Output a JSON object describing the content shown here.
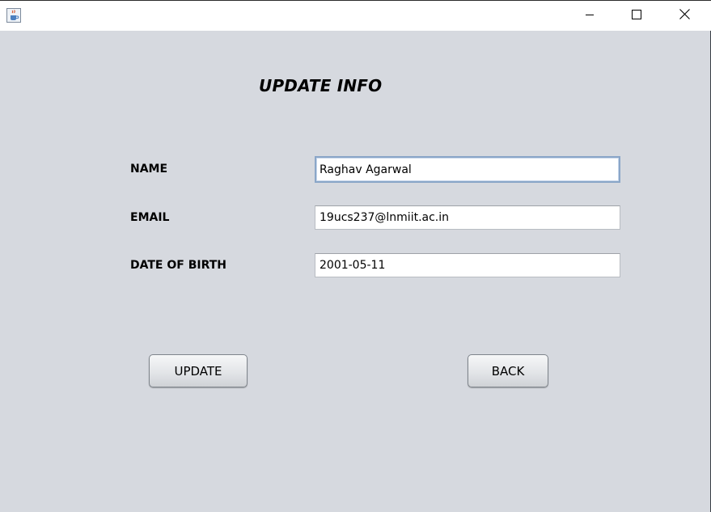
{
  "window": {
    "controls": {
      "minimize_icon": "minimize-icon",
      "maximize_icon": "maximize-icon",
      "close_icon": "close-icon"
    },
    "app_icon": "java-cup-icon"
  },
  "form": {
    "title": "UPDATE INFO",
    "name_label": "NAME",
    "name_value": "Raghav Agarwal",
    "email_label": "EMAIL",
    "email_value": "19ucs237@lnmiit.ac.in",
    "dob_label": "DATE OF BIRTH",
    "dob_value": "2001-05-11"
  },
  "buttons": {
    "update_label": "UPDATE",
    "back_label": "BACK"
  },
  "colors": {
    "background": "#d6d9df",
    "focus_border": "#8aa6c8"
  }
}
